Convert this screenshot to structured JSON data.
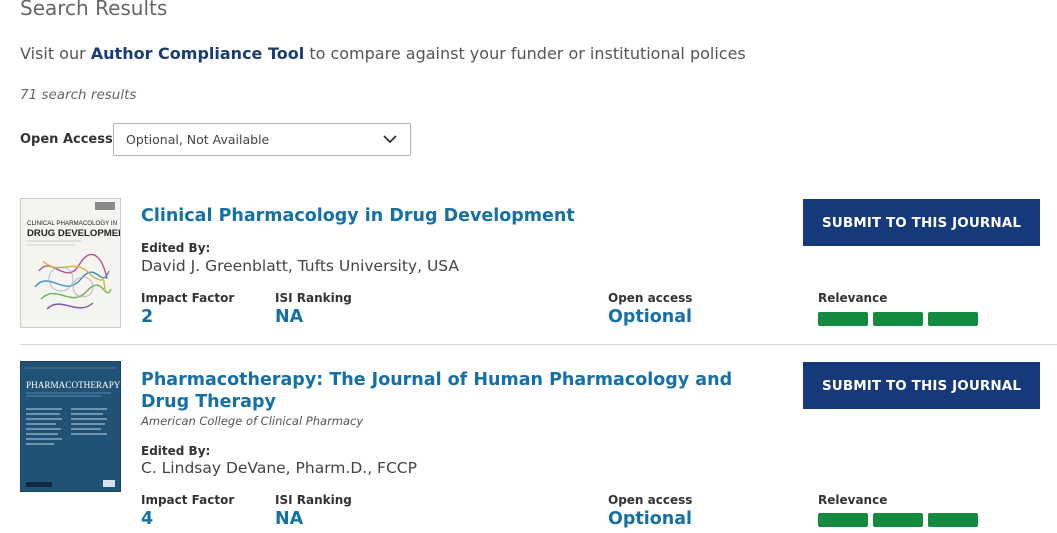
{
  "page": {
    "title": "Search Results",
    "compliance_prefix": "Visit our ",
    "compliance_link": "Author Compliance Tool",
    "compliance_suffix": " to compare against your funder or institutional polices",
    "result_count": "71 search results",
    "open_access_label": "Open Access:",
    "open_access_value": "Optional, Not Available"
  },
  "labels": {
    "edited_by": "Edited By:",
    "impact_factor": "Impact Factor",
    "isi_ranking": "ISI Ranking",
    "open_access": "Open access",
    "relevance": "Relevance",
    "submit": "SUBMIT TO THIS JOURNAL"
  },
  "journals": [
    {
      "title": "Clinical Pharmacology in Drug Development",
      "society": "",
      "editor": "David J. Greenblatt, Tufts University, USA",
      "impact_factor": "2",
      "isi_ranking": "NA",
      "open_access": "Optional",
      "relevance_bars": 3,
      "cover_title_line1": "CLINICAL PHARMACOLOGY IN",
      "cover_title_line2": "DRUG DEVELOPMENT"
    },
    {
      "title": "Pharmacotherapy: The Journal of Human Pharmacology and Drug Therapy",
      "society": "American College of Clinical Pharmacy",
      "editor": "C. Lindsay DeVane, Pharm.D., FCCP",
      "impact_factor": "4",
      "isi_ranking": "NA",
      "open_access": "Optional",
      "relevance_bars": 3,
      "cover_title_line1": "PHARMACOTHERAPY"
    }
  ],
  "colors": {
    "link_blue": "#1570a6",
    "navy_button": "#15397a",
    "relevance_green": "#138a3e"
  }
}
